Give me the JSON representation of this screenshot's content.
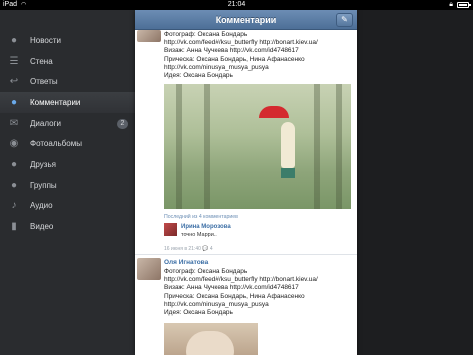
{
  "status_bar": {
    "carrier": "iPad",
    "time": "21:04"
  },
  "sidebar": {
    "items": [
      {
        "label": "Новости",
        "icon": "news-icon",
        "glyph": "💬",
        "active": false
      },
      {
        "label": "Стена",
        "icon": "wall-icon",
        "glyph": "☰",
        "active": false
      },
      {
        "label": "Ответы",
        "icon": "reply-icon",
        "glyph": "↩",
        "active": false
      },
      {
        "label": "Комментарии",
        "icon": "comments-icon",
        "glyph": "💬",
        "active": true
      },
      {
        "label": "Диалоги",
        "icon": "dialogs-icon",
        "glyph": "✉",
        "active": false,
        "badge": "2"
      },
      {
        "label": "Фотоальбомы",
        "icon": "camera-icon",
        "glyph": "◉",
        "active": false
      },
      {
        "label": "Друзья",
        "icon": "friends-icon",
        "glyph": "●",
        "active": false
      },
      {
        "label": "Группы",
        "icon": "groups-icon",
        "glyph": "●●",
        "active": false
      },
      {
        "label": "Аудио",
        "icon": "music-icon",
        "glyph": "♪",
        "active": false
      },
      {
        "label": "Видео",
        "icon": "video-icon",
        "glyph": "▮",
        "active": false
      }
    ]
  },
  "navbar": {
    "title": "Комментарии"
  },
  "post1": {
    "lines": [
      "Фотограф: Оксана Бондарь",
      "http://vk.com/feed#/ksu_butterfly http://bonart.kiev.ua/",
      "Визаж: Анна Чучкева http://vk.com/id4748617",
      "Прическа: Оксана Бондарь, Нина Афанасенко",
      "http://vk.com/ninusya_musya_pusya",
      "Идея: Оксана Бондарь"
    ],
    "comments_meta": "Последний из 4 комментариев",
    "comment_author": "Ирина Морозова",
    "comment_text": "точно Марри..",
    "footer": "16 июня в 21:40   💬 4"
  },
  "post2": {
    "author": "Оля Игнатова",
    "lines": [
      "Фотограф: Оксана Бондарь",
      "http://vk.com/feed#/ksu_butterfly http://bonart.kiev.ua/",
      "Визаж: Анна Чучкева http://vk.com/id4748617",
      "Прическа: Оксана Бондарь, Нина Афанасенко",
      "http://vk.com/ninusya_musya_pusya",
      "Идея: Оксана Бондарь"
    ]
  },
  "colors": {
    "nav": "#5a7ca5",
    "sidebar": "#2a2c2f",
    "link": "#3b6ea5",
    "accent": "#d42a2f"
  }
}
